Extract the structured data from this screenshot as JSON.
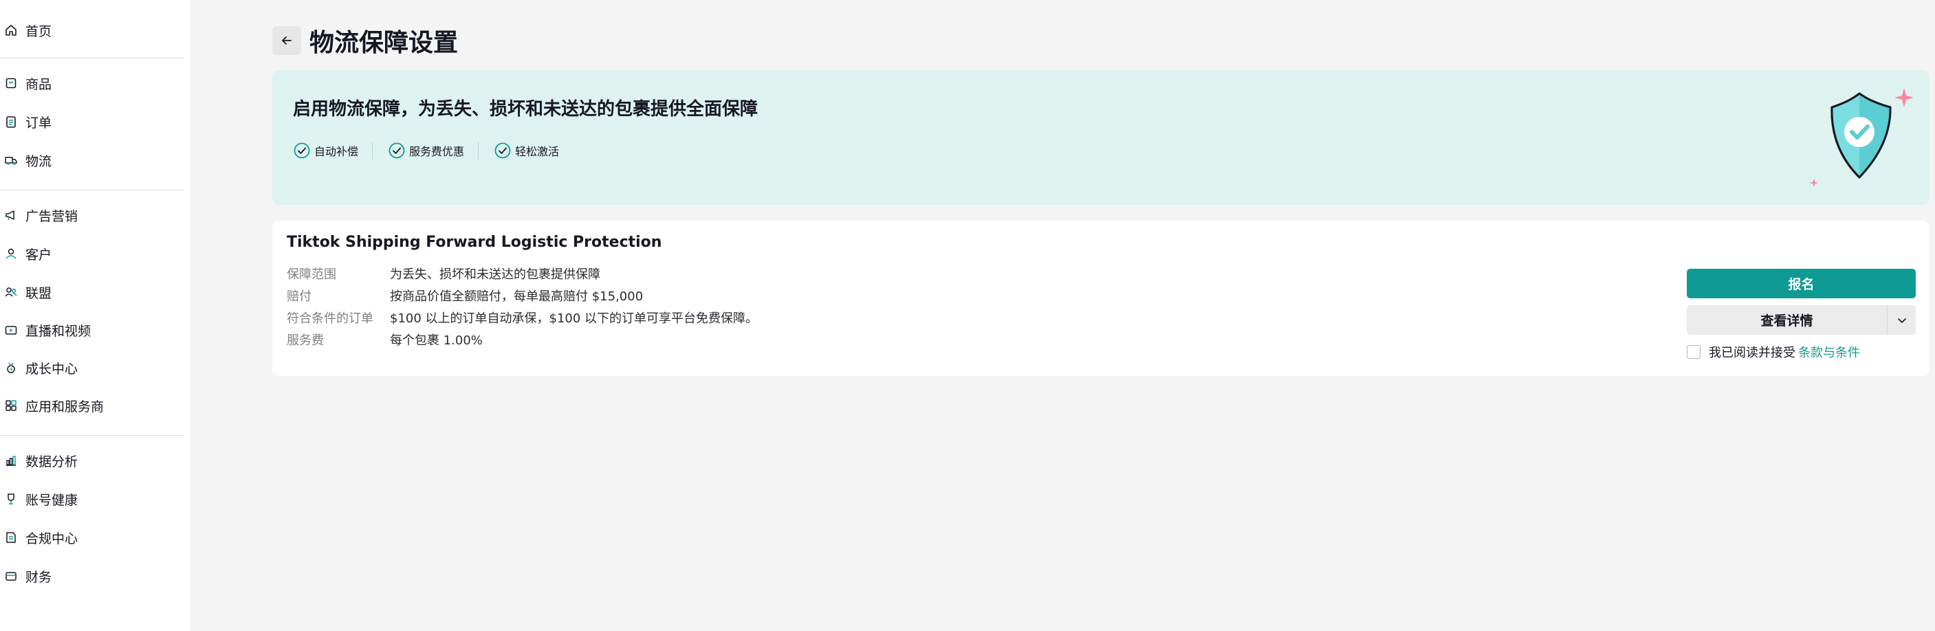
{
  "sidebar": {
    "items": [
      {
        "label": "首页",
        "icon": "home-icon"
      },
      {
        "label": "商品",
        "icon": "product-icon"
      },
      {
        "label": "订单",
        "icon": "order-icon"
      },
      {
        "label": "物流",
        "icon": "truck-icon"
      },
      {
        "label": "广告营销",
        "icon": "megaphone-icon"
      },
      {
        "label": "客户",
        "icon": "customer-icon"
      },
      {
        "label": "联盟",
        "icon": "affiliate-icon"
      },
      {
        "label": "直播和视频",
        "icon": "video-icon"
      },
      {
        "label": "成长中心",
        "icon": "medal-icon"
      },
      {
        "label": "应用和服务商",
        "icon": "apps-icon"
      },
      {
        "label": "数据分析",
        "icon": "chart-icon"
      },
      {
        "label": "账号健康",
        "icon": "trophy-icon"
      },
      {
        "label": "合规中心",
        "icon": "document-icon"
      },
      {
        "label": "财务",
        "icon": "wallet-icon"
      }
    ]
  },
  "header": {
    "title": "物流保障设置"
  },
  "banner": {
    "title": "启用物流保障，为丢失、损坏和未送达的包裹提供全面保障",
    "features": [
      "自动补偿",
      "服务费优惠",
      "轻松激活"
    ],
    "accent_color": "#0f9b94",
    "background_color": "#def2ef"
  },
  "card": {
    "title": "Tiktok Shipping Forward Logistic Protection",
    "rows": [
      {
        "label": "保障范围",
        "value": "为丢失、损坏和未送达的包裹提供保障"
      },
      {
        "label": "赔付",
        "value": "按商品价值全额赔付，每单最高赔付 $15,000"
      },
      {
        "label": "符合条件的订单",
        "value": "$100 以上的订单自动承保，$100 以下的订单可享平台免费保障。"
      },
      {
        "label": "服务费",
        "value": "每个包裹 1.00%"
      }
    ],
    "primary_button": "报名",
    "details_button": "查看详情",
    "terms_text": "我已阅读并接受",
    "terms_link": "条款与条件"
  }
}
